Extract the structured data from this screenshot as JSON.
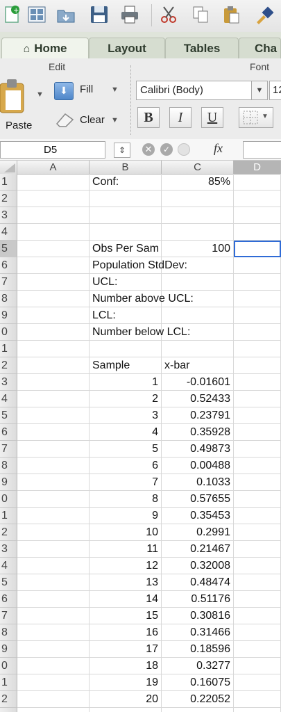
{
  "toolbar": {
    "icons": [
      "new-workbook-icon",
      "templates-icon",
      "open-icon",
      "save-icon",
      "print-icon",
      "cut-icon",
      "copy-icon",
      "paste-icon",
      "format-painter-icon"
    ]
  },
  "tabs": [
    {
      "label": "Home",
      "active": true
    },
    {
      "label": "Layout",
      "active": false
    },
    {
      "label": "Tables",
      "active": false
    },
    {
      "label": "Cha",
      "active": false
    }
  ],
  "ribbon": {
    "edit_label": "Edit",
    "font_label": "Font",
    "paste_label": "Paste",
    "fill_label": "Fill",
    "clear_label": "Clear",
    "font_name": "Calibri (Body)",
    "font_size": "12",
    "bold": "B",
    "italic": "I",
    "underline": "U"
  },
  "formula_bar": {
    "name_box": "D5",
    "fx": "fx",
    "value": ""
  },
  "columns": [
    "A",
    "B",
    "C",
    "D"
  ],
  "row_numbers": [
    "1",
    "2",
    "3",
    "4",
    "5",
    "6",
    "7",
    "8",
    "9",
    "0",
    "1",
    "2",
    "3",
    "4",
    "5",
    "6",
    "7",
    "8",
    "9",
    "0",
    "1",
    "2",
    "3",
    "4",
    "5",
    "6",
    "7",
    "8",
    "9",
    "0",
    "1",
    "2"
  ],
  "cells": {
    "B1": "Conf:",
    "C1": "85%",
    "B5": "Obs Per Sam",
    "C5": "100",
    "B6": "Population StdDev:",
    "B7": "UCL:",
    "B8": "Number above UCL:",
    "B9": "LCL:",
    "B10": "Number below LCL:",
    "B12": "Sample",
    "C12": "x-bar"
  },
  "samples": [
    {
      "n": "1",
      "xbar": "-0.01601"
    },
    {
      "n": "2",
      "xbar": "0.52433"
    },
    {
      "n": "3",
      "xbar": "0.23791"
    },
    {
      "n": "4",
      "xbar": "0.35928"
    },
    {
      "n": "5",
      "xbar": "0.49873"
    },
    {
      "n": "6",
      "xbar": "0.00488"
    },
    {
      "n": "7",
      "xbar": "0.1033"
    },
    {
      "n": "8",
      "xbar": "0.57655"
    },
    {
      "n": "9",
      "xbar": "0.35453"
    },
    {
      "n": "10",
      "xbar": "0.2991"
    },
    {
      "n": "11",
      "xbar": "0.21467"
    },
    {
      "n": "12",
      "xbar": "0.32008"
    },
    {
      "n": "13",
      "xbar": "0.48474"
    },
    {
      "n": "14",
      "xbar": "0.51176"
    },
    {
      "n": "15",
      "xbar": "0.30816"
    },
    {
      "n": "16",
      "xbar": "0.31466"
    },
    {
      "n": "17",
      "xbar": "0.18596"
    },
    {
      "n": "18",
      "xbar": "0.3277"
    },
    {
      "n": "19",
      "xbar": "0.16075"
    },
    {
      "n": "20",
      "xbar": "0.22052"
    }
  ],
  "selected_cell": "D5",
  "colors": {
    "selection": "#2f6bd6",
    "home_icon": "#2e3b2d"
  }
}
